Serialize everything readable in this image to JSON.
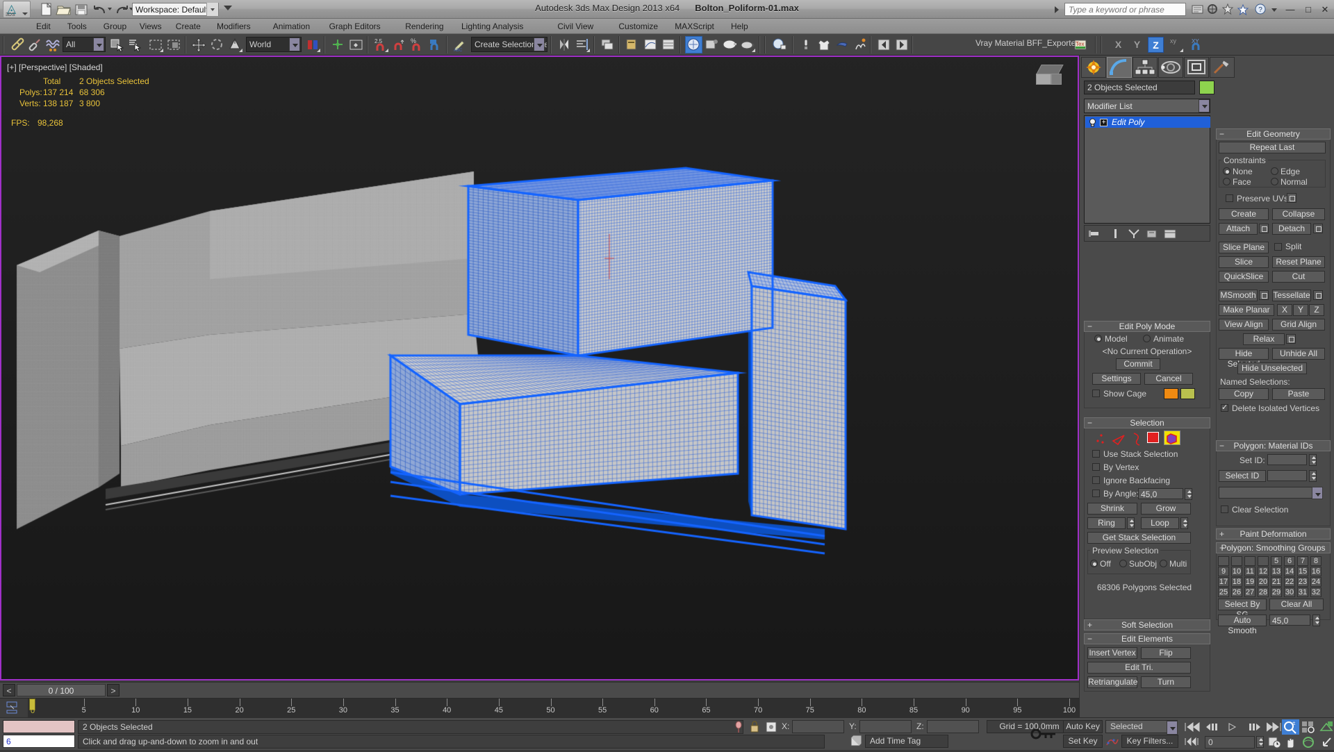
{
  "titlebar": {
    "app_title": "Autodesk 3ds Max Design 2013 x64",
    "file_title": "Bolton_Poliform-01.max",
    "workspace": "Workspace: Default",
    "search_placeholder": "Type a keyword or phrase",
    "logo_label": "3DS",
    "window_buttons": [
      "—",
      "□",
      "✕"
    ]
  },
  "menu": [
    "Edit",
    "Tools",
    "Group",
    "Views",
    "Create",
    "Modifiers",
    "Animation",
    "Graph Editors",
    "Rendering",
    "Lighting Analysis",
    "Civil View",
    "Customize",
    "MAXScript",
    "Help"
  ],
  "toolbar": {
    "selection_filter": "All",
    "ref_coord_system": "World",
    "named_selection_sets": "Create Selection Se",
    "material_label": "Vray Material  BFF_Exporter",
    "axis_buttons": [
      "X",
      "Y",
      "Z",
      "XY"
    ],
    "active_axis": "Z"
  },
  "viewport": {
    "label": "[+] [Perspective] [Shaded]",
    "stats_header_total": "Total",
    "stats_header_sel": "2 Objects Selected",
    "rows": [
      {
        "name": "Polys:",
        "total": "137 214",
        "sel": "68 306"
      },
      {
        "name": "Verts:",
        "total": "138 187",
        "sel": "3 800"
      }
    ],
    "fps_label": "FPS:",
    "fps_value": "98,268"
  },
  "timeslider": {
    "prev": "<",
    "frame": "0 / 100",
    "next": ">",
    "playhead_label": "0",
    "ticks": [
      5,
      10,
      15,
      20,
      25,
      30,
      35,
      40,
      45,
      50,
      55,
      60,
      65,
      70,
      75,
      80,
      85,
      90,
      95,
      100
    ]
  },
  "statusbar": {
    "maxscript_value": "6",
    "selection_status": "2 Objects Selected",
    "prompt": "Click and drag up-and-down to zoom in and out",
    "coord_labels": [
      "X:",
      "Y:",
      "Z:"
    ],
    "coord_values": [
      "",
      "",
      ""
    ],
    "grid": "Grid = 100,0mm",
    "add_time_tag": "Add Time Tag",
    "auto_key": "Auto Key",
    "set_key": "Set Key",
    "key_mode": "Selected",
    "key_filters": "Key Filters...",
    "current_frame": "0"
  },
  "command_panel": {
    "object_name": "2 Objects Selected",
    "object_color": "#8ed44e",
    "modifier_list_label": "Modifier List",
    "stack": [
      {
        "label": "Edit Poly",
        "selected": true
      }
    ],
    "edit_poly_mode": {
      "title": "Edit Poly Mode",
      "mode_model": "Model",
      "mode_animate": "Animate",
      "active_mode": "Model",
      "current_operation": "<No Current Operation>",
      "commit": "Commit",
      "settings": "Settings",
      "cancel": "Cancel",
      "show_cage": "Show Cage",
      "cage_color_1": "#ef8a12",
      "cage_color_2": "#b9c04e"
    },
    "selection": {
      "title": "Selection",
      "subobject_icons": [
        "vertex-icon",
        "edge-icon",
        "border-icon",
        "polygon-icon",
        "element-icon"
      ],
      "active_subobject": "element-icon",
      "use_stack_selection": "Use Stack Selection",
      "by_vertex": "By Vertex",
      "ignore_backfacing": "Ignore Backfacing",
      "by_angle": "By Angle:",
      "by_angle_value": "45,0",
      "shrink": "Shrink",
      "grow": "Grow",
      "ring": "Ring",
      "loop": "Loop",
      "get_stack_selection": "Get Stack Selection",
      "preview_selection": "Preview Selection",
      "preview_off": "Off",
      "preview_subobj": "SubObj",
      "preview_multi": "Multi",
      "preview_active": "Off",
      "status": "68306 Polygons Selected"
    },
    "soft_selection": {
      "title": "Soft Selection",
      "expanded": false
    },
    "edit_elements": {
      "title": "Edit Elements",
      "insert_vertex": "Insert Vertex",
      "flip": "Flip",
      "edit_tri": "Edit Tri.",
      "retriangulate": "Retriangulate",
      "turn": "Turn"
    },
    "edit_geometry": {
      "title": "Edit Geometry",
      "repeat_last": "Repeat Last",
      "constraints_title": "Constraints",
      "constraints": [
        "None",
        "Edge",
        "Face",
        "Normal"
      ],
      "constraint_active": "None",
      "preserve_uvs": "Preserve UVs",
      "create": "Create",
      "collapse": "Collapse",
      "attach": "Attach",
      "detach": "Detach",
      "slice_plane": "Slice Plane",
      "split": "Split",
      "slice": "Slice",
      "reset_plane": "Reset Plane",
      "quickslice": "QuickSlice",
      "cut": "Cut",
      "msmooth": "MSmooth",
      "tessellate": "Tessellate",
      "make_planar": "Make Planar",
      "axis_x": "X",
      "axis_y": "Y",
      "axis_z": "Z",
      "view_align": "View Align",
      "grid_align": "Grid Align",
      "relax": "Relax",
      "hide_selected": "Hide Selected",
      "unhide_all": "Unhide All",
      "hide_unselected": "Hide Unselected",
      "named_selections": "Named Selections:",
      "copy": "Copy",
      "paste": "Paste",
      "delete_isolated_vertices": "Delete Isolated Vertices"
    },
    "material_ids": {
      "title": "Polygon: Material IDs",
      "set_id": "Set ID:",
      "set_id_value": "",
      "select_id": "Select ID",
      "select_id_value": "",
      "id_list_value": "",
      "clear_selection": "Clear Selection"
    },
    "paint_deformation": {
      "title": "Paint Deformation",
      "expanded": false
    },
    "smoothing_groups": {
      "title": "Polygon: Smoothing Groups",
      "cells": [
        "",
        "",
        "",
        "",
        "5",
        "6",
        "7",
        "8",
        "9",
        "10",
        "11",
        "12",
        "13",
        "14",
        "15",
        "16",
        "17",
        "18",
        "19",
        "20",
        "21",
        "22",
        "23",
        "24",
        "25",
        "26",
        "27",
        "28",
        "29",
        "30",
        "31",
        "32"
      ],
      "select_by_sg": "Select By SG",
      "clear_all": "Clear All",
      "auto_smooth": "Auto Smooth",
      "auto_smooth_value": "45,0"
    }
  }
}
